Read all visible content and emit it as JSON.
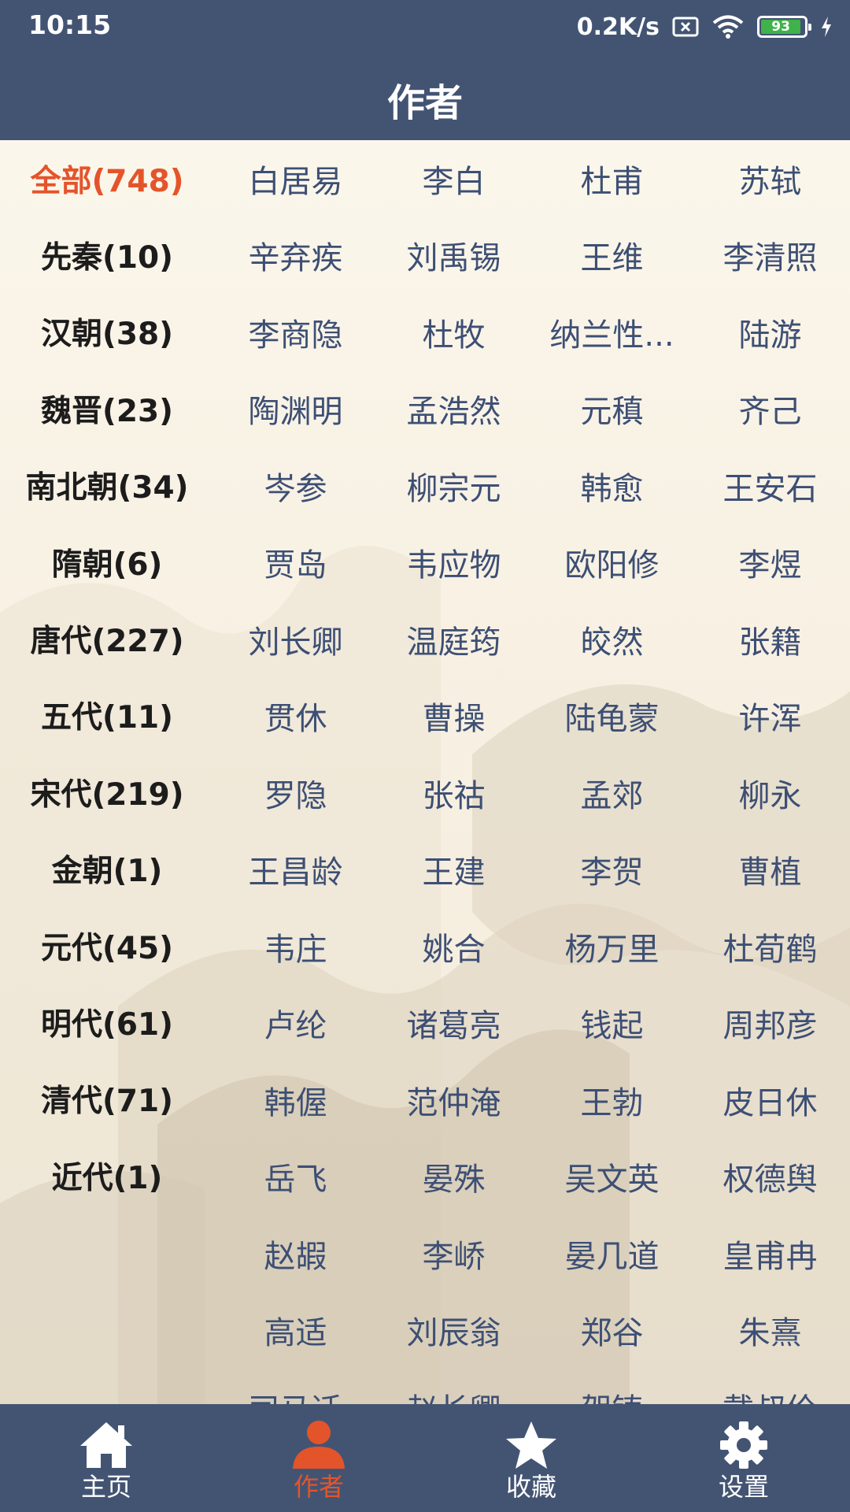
{
  "status_bar": {
    "time": "10:15",
    "net_speed": "0.2K/s",
    "battery": "93",
    "battery_level": 0.93
  },
  "header": {
    "title": "作者"
  },
  "dynasties": [
    {
      "label": "全部(748)",
      "active": true
    },
    {
      "label": "先秦(10)"
    },
    {
      "label": "汉朝(38)"
    },
    {
      "label": "魏晋(23)"
    },
    {
      "label": "南北朝(34)"
    },
    {
      "label": "隋朝(6)"
    },
    {
      "label": "唐代(227)"
    },
    {
      "label": "五代(11)"
    },
    {
      "label": "宋代(219)"
    },
    {
      "label": "金朝(1)"
    },
    {
      "label": "元代(45)"
    },
    {
      "label": "明代(61)"
    },
    {
      "label": "清代(71)"
    },
    {
      "label": "近代(1)"
    }
  ],
  "authors": [
    "白居易",
    "李白",
    "杜甫",
    "苏轼",
    "辛弃疾",
    "刘禹锡",
    "王维",
    "李清照",
    "李商隐",
    "杜牧",
    "纳兰性...",
    "陆游",
    "陶渊明",
    "孟浩然",
    "元稹",
    "齐己",
    "岑参",
    "柳宗元",
    "韩愈",
    "王安石",
    "贾岛",
    "韦应物",
    "欧阳修",
    "李煜",
    "刘长卿",
    "温庭筠",
    "皎然",
    "张籍",
    "贯休",
    "曹操",
    "陆龟蒙",
    "许浑",
    "罗隐",
    "张祜",
    "孟郊",
    "柳永",
    "王昌龄",
    "王建",
    "李贺",
    "曹植",
    "韦庄",
    "姚合",
    "杨万里",
    "杜荀鹤",
    "卢纶",
    "诸葛亮",
    "钱起",
    "周邦彦",
    "韩偓",
    "范仲淹",
    "王勃",
    "皮日休",
    "岳飞",
    "晏殊",
    "吴文英",
    "权德舆",
    "赵嘏",
    "李峤",
    "晏几道",
    "皇甫冉",
    "高适",
    "刘辰翁",
    "郑谷",
    "朱熹",
    "司马迁",
    "赵长卿",
    "贺铸",
    "戴叔伦"
  ],
  "bottom_nav": [
    {
      "label": "主页",
      "icon": "home-icon"
    },
    {
      "label": "作者",
      "icon": "person-icon",
      "active": true
    },
    {
      "label": "收藏",
      "icon": "star-icon"
    },
    {
      "label": "设置",
      "icon": "gear-icon"
    }
  ],
  "colors": {
    "header_bg": "#435473",
    "active": "#E4542B",
    "author_text": "#3D4F74",
    "battery_green": "#3FB24A"
  }
}
